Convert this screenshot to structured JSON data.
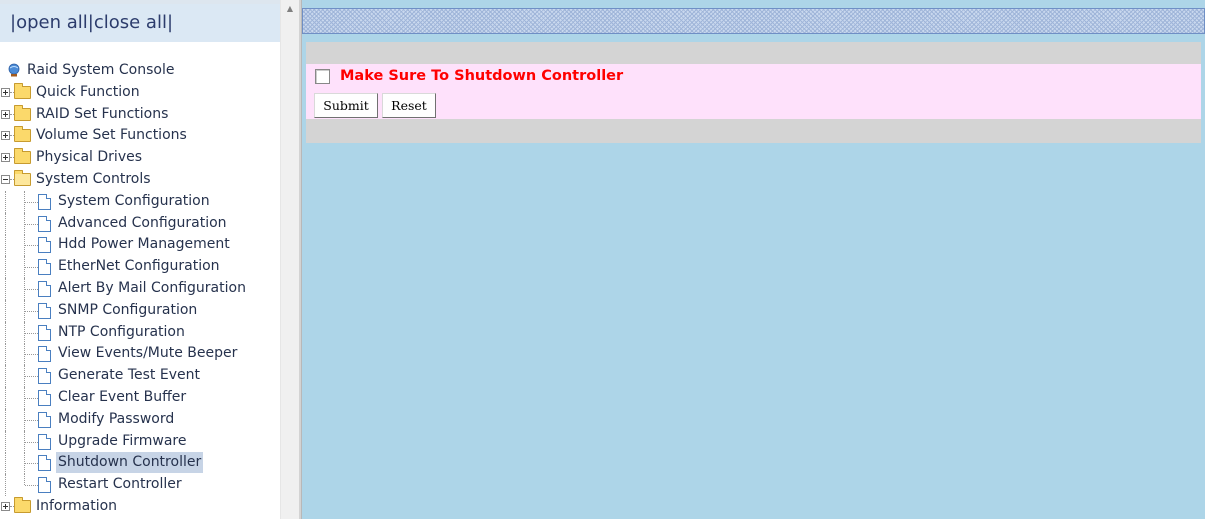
{
  "nav": {
    "open_all": "open all",
    "close_all": "close all",
    "separator": "|"
  },
  "tree": {
    "root": "Raid System Console",
    "folders": [
      "Quick Function",
      "RAID Set Functions",
      "Volume Set Functions",
      "Physical Drives"
    ],
    "expanded_folder": "System Controls",
    "children": [
      "System Configuration",
      "Advanced Configuration",
      "Hdd Power Management",
      "EtherNet Configuration",
      "Alert By Mail Configuration",
      "SNMP Configuration",
      "NTP Configuration",
      "View Events/Mute Beeper",
      "Generate Test Event",
      "Clear Event Buffer",
      "Modify Password",
      "Upgrade Firmware",
      "Shutdown Controller",
      "Restart Controller"
    ],
    "selected": "Shutdown Controller",
    "last_folder": "Information"
  },
  "form": {
    "confirm_label": "Make Sure To Shutdown Controller",
    "confirm_checked": false,
    "submit_label": "Submit",
    "reset_label": "Reset"
  },
  "colors": {
    "content_bg": "#add5e8",
    "confirm_text": "#ff0000",
    "form_row_bg": "#fee1fb"
  },
  "icons": {
    "root": "globe-icon",
    "folder": "folder-icon",
    "page": "page-icon",
    "expand": "plus-icon",
    "collapse": "minus-icon"
  }
}
